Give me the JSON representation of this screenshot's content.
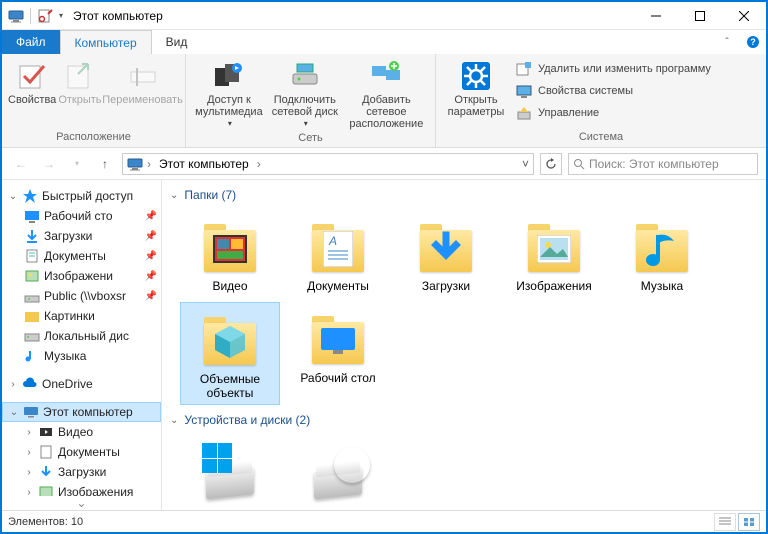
{
  "title": "Этот компьютер",
  "menu": {
    "file": "Файл",
    "computer": "Компьютер",
    "view": "Вид"
  },
  "ribbon": {
    "loc_group": "Расположение",
    "net_group": "Сеть",
    "sys_group": "Система",
    "props": "Свойства",
    "open": "Открыть",
    "rename": "Переименовать",
    "media": "Доступ к мультимедиа",
    "netdrive": "Подключить сетевой диск",
    "addnet": "Добавить сетевое расположение",
    "settings": "Открыть параметры",
    "uninstall": "Удалить или изменить программу",
    "sysprops": "Свойства системы",
    "manage": "Управление"
  },
  "breadcrumb": {
    "root": "Этот компьютер"
  },
  "search_placeholder": "Поиск: Этот компьютер",
  "tree": {
    "quick": "Быстрый доступ",
    "desktop": "Рабочий сто",
    "downloads": "Загрузки",
    "documents": "Документы",
    "pictures": "Изображени",
    "public": "Public (\\\\vboxsr",
    "pictures2": "Картинки",
    "localdisk": "Локальный дис",
    "music": "Музыка",
    "onedrive": "OneDrive",
    "thispc": "Этот компьютер",
    "video": "Видео",
    "docs2": "Документы",
    "downloads2": "Загрузки",
    "pictures3": "Изображения"
  },
  "sections": {
    "folders": "Папки (7)",
    "drives": "Устройства и диски (2)"
  },
  "folders": {
    "video": "Видео",
    "documents": "Документы",
    "downloads": "Загрузки",
    "pictures": "Изображения",
    "music": "Музыка",
    "objects3d": "Объемные объекты",
    "desktop": "Рабочий стол"
  },
  "status": {
    "elements": "Элементов: 10"
  }
}
